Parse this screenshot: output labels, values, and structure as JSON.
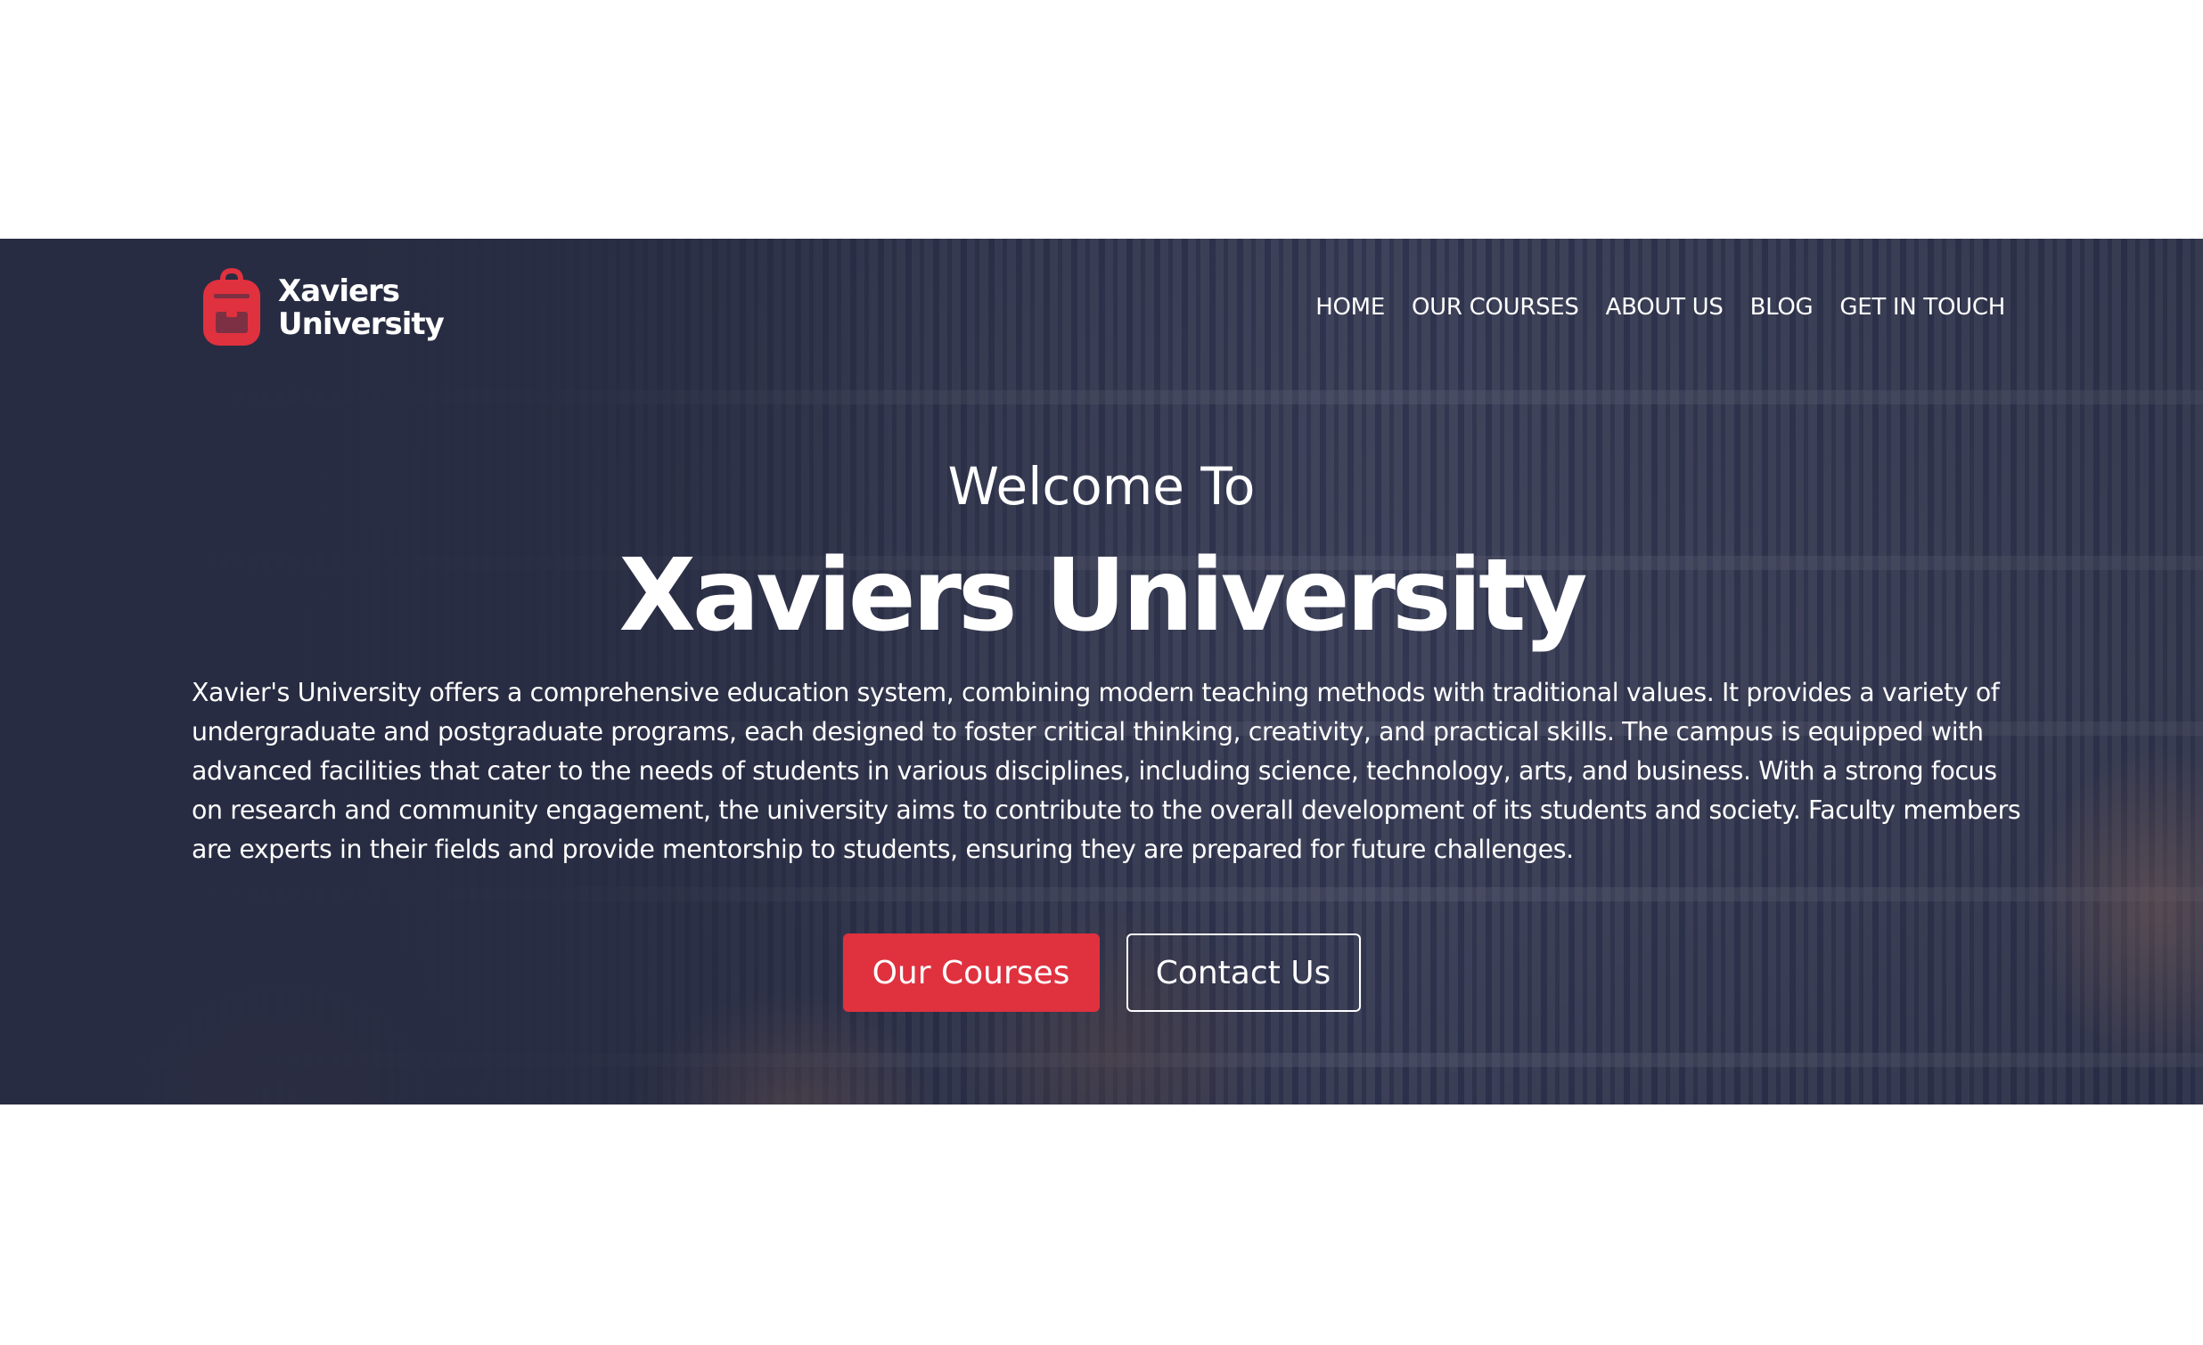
{
  "brand": {
    "name_line1": "Xaviers",
    "name_line2": "University",
    "icon": "backpack-icon",
    "accent_color": "#e0313f"
  },
  "nav": {
    "items": [
      {
        "label": "HOME"
      },
      {
        "label": "OUR COURSES"
      },
      {
        "label": "ABOUT US"
      },
      {
        "label": "BLOG"
      },
      {
        "label": "GET IN TOUCH"
      }
    ]
  },
  "hero": {
    "welcome": "Welcome To",
    "title": "Xaviers University",
    "description": "Xavier's University offers a comprehensive education system, combining modern teaching methods with traditional values. It provides a variety of undergraduate and postgraduate programs, each designed to foster critical thinking, creativity, and practical skills. The campus is equipped with advanced facilities that cater to the needs of students in various disciplines, including science, technology, arts, and business. With a strong focus on research and community engagement, the university aims to contribute to the overall development of its students and society. Faculty members are experts in their fields and provide mentorship to students, ensuring they are prepared for future challenges.",
    "primary_button": "Our Courses",
    "secondary_button": "Contact Us"
  }
}
